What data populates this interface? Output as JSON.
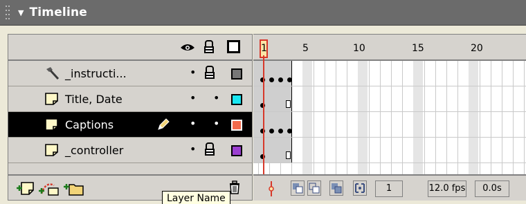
{
  "panel": {
    "title": "Timeline"
  },
  "layers_header": {
    "eye_icon": "eye-icon",
    "lock_icon": "lock-icon",
    "outline_icon": "outline-box-icon"
  },
  "layers": [
    {
      "name": "_instructi...",
      "type": "guide-layer-icon",
      "visible": "•",
      "locked": true,
      "color": "#777777",
      "selected": false
    },
    {
      "name": "Title, Date",
      "type": "layer-icon",
      "visible": "•",
      "locked": false,
      "color": "#19e7f2",
      "selected": false
    },
    {
      "name": "Captions",
      "type": "layer-icon",
      "visible": "•",
      "locked": false,
      "color": "#f26a4c",
      "selected": true
    },
    {
      "name": "_controller",
      "type": "layer-icon",
      "visible": "•",
      "locked": true,
      "color": "#9b3fd0",
      "selected": false
    }
  ],
  "lock_dot": "•",
  "ruler": {
    "ticks": [
      "1",
      "5",
      "10",
      "15",
      "20"
    ]
  },
  "footer": {
    "current_frame": "1",
    "frame_rate": "12.0 fps",
    "elapsed": "0.0s"
  },
  "tooltip": {
    "text": "Layer Name"
  },
  "colors": {
    "selection": "#000000",
    "playhead": "#d7382a",
    "titlebar": "#6b6b6b"
  }
}
